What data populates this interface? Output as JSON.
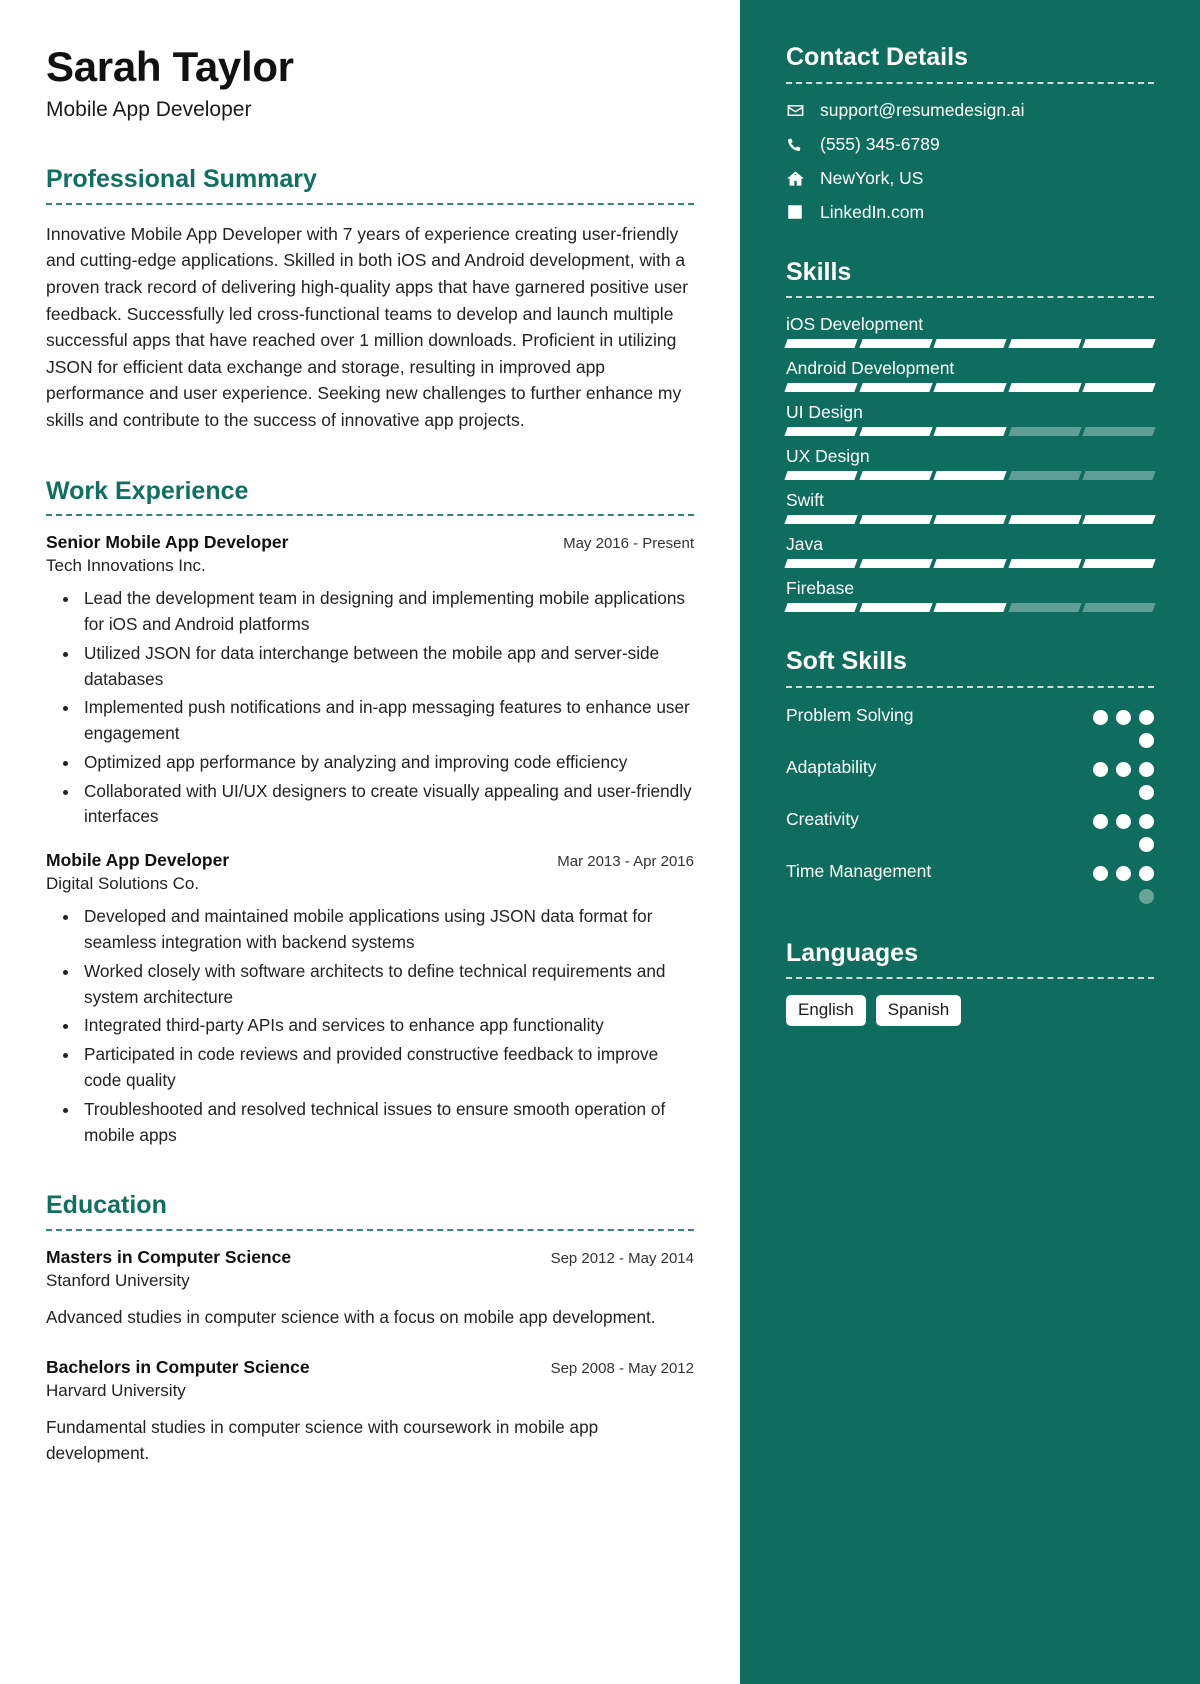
{
  "theme": {
    "accent": "#107060",
    "sidebar_bg": "#0e6d5e",
    "page_bg": "#ffffff",
    "text": "#222222"
  },
  "header": {
    "name": "Sarah Taylor",
    "job_title": "Mobile App Developer"
  },
  "summary": {
    "heading": "Professional Summary",
    "text": "Innovative Mobile App Developer with 7 years of experience creating user-friendly and cutting-edge applications. Skilled in both iOS and Android development, with a proven track record of delivering high-quality apps that have garnered positive user feedback. Successfully led cross-functional teams to develop and launch multiple successful apps that have reached over 1 million downloads. Proficient in utilizing JSON for efficient data exchange and storage, resulting in improved app performance and user experience. Seeking new challenges to further enhance my skills and contribute to the success of innovative app projects."
  },
  "work": {
    "heading": "Work Experience",
    "entries": [
      {
        "role": "Senior Mobile App Developer",
        "date": "May 2016 - Present",
        "org": "Tech Innovations Inc.",
        "bullets": [
          "Lead the development team in designing and implementing mobile applications for iOS and Android platforms",
          "Utilized JSON for data interchange between the mobile app and server-side databases",
          "Implemented push notifications and in-app messaging features to enhance user engagement",
          "Optimized app performance by analyzing and improving code efficiency",
          "Collaborated with UI/UX designers to create visually appealing and user-friendly interfaces"
        ]
      },
      {
        "role": "Mobile App Developer",
        "date": "Mar 2013 - Apr 2016",
        "org": "Digital Solutions Co.",
        "bullets": [
          "Developed and maintained mobile applications using JSON data format for seamless integration with backend systems",
          "Worked closely with software architects to define technical requirements and system architecture",
          "Integrated third-party APIs and services to enhance app functionality",
          "Participated in code reviews and provided constructive feedback to improve code quality",
          "Troubleshooted and resolved technical issues to ensure smooth operation of mobile apps"
        ]
      }
    ]
  },
  "education": {
    "heading": "Education",
    "entries": [
      {
        "degree": "Masters in Computer Science",
        "date": "Sep 2012 - May 2014",
        "school": "Stanford University",
        "description": "Advanced studies in computer science with a focus on mobile app development."
      },
      {
        "degree": "Bachelors in Computer Science",
        "date": "Sep 2008 - May 2012",
        "school": "Harvard University",
        "description": "Fundamental studies in computer science with coursework in mobile app development."
      }
    ]
  },
  "contact": {
    "heading": "Contact Details",
    "items": [
      {
        "icon": "envelope-icon",
        "value": "support@resumedesign.ai"
      },
      {
        "icon": "phone-icon",
        "value": "(555) 345-6789"
      },
      {
        "icon": "home-icon",
        "value": "NewYork, US"
      },
      {
        "icon": "linkedin-icon",
        "value": "LinkedIn.com"
      }
    ]
  },
  "skills": {
    "heading": "Skills",
    "total_segments": 5,
    "items": [
      {
        "label": "iOS Development",
        "filled": 5
      },
      {
        "label": "Android Development",
        "filled": 5
      },
      {
        "label": "UI Design",
        "filled": 3
      },
      {
        "label": "UX Design",
        "filled": 3
      },
      {
        "label": "Swift",
        "filled": 5
      },
      {
        "label": "Java",
        "filled": 5
      },
      {
        "label": "Firebase",
        "filled": 3
      }
    ]
  },
  "soft_skills": {
    "heading": "Soft Skills",
    "total_dots": 4,
    "items": [
      {
        "label": "Problem Solving",
        "filled": 4
      },
      {
        "label": "Adaptability",
        "filled": 4
      },
      {
        "label": "Creativity",
        "filled": 4
      },
      {
        "label": "Time Management",
        "filled": 3
      }
    ]
  },
  "languages": {
    "heading": "Languages",
    "items": [
      "English",
      "Spanish"
    ]
  }
}
